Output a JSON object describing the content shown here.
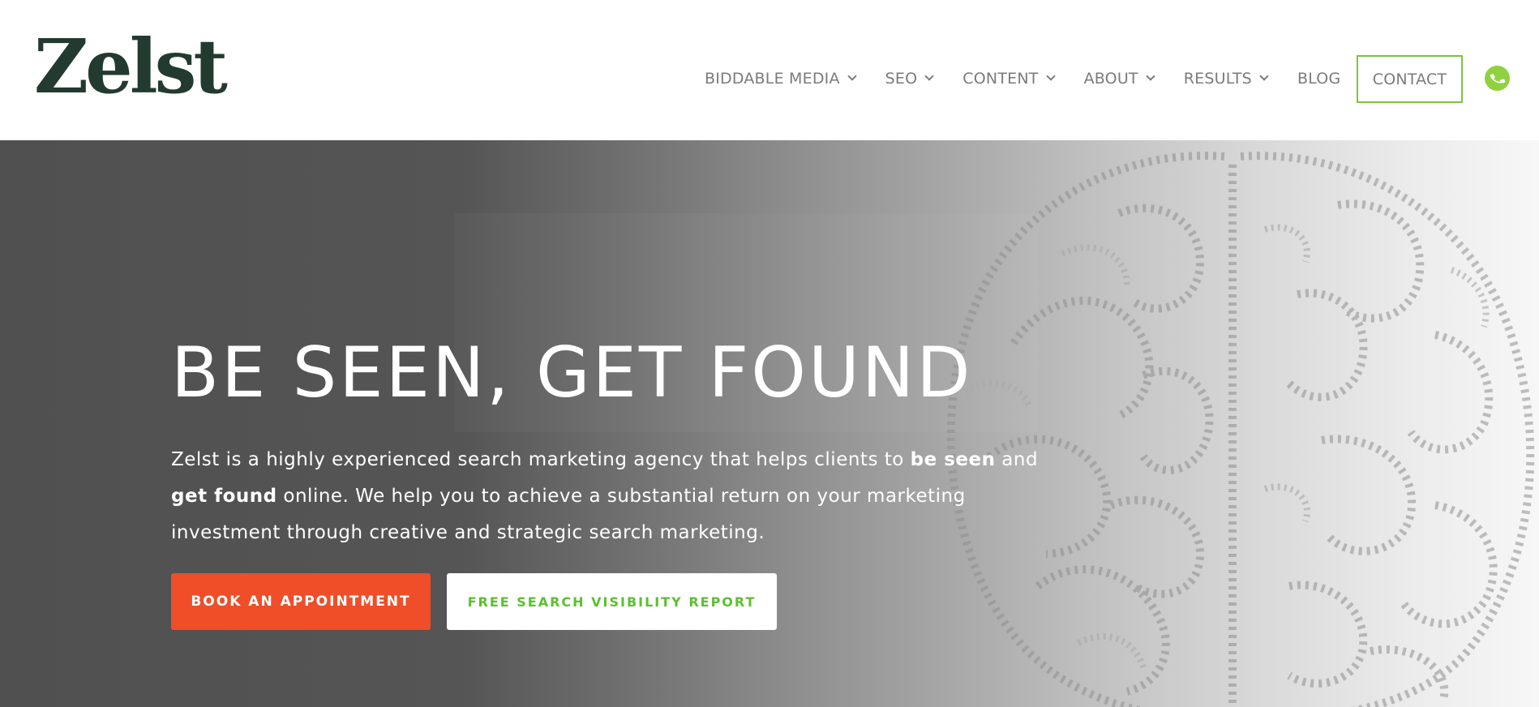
{
  "header": {
    "logo": "Zelst",
    "nav": [
      {
        "label": "BIDDABLE MEDIA",
        "dropdown": true
      },
      {
        "label": "SEO",
        "dropdown": true
      },
      {
        "label": "CONTENT",
        "dropdown": true
      },
      {
        "label": "ABOUT",
        "dropdown": true
      },
      {
        "label": "RESULTS",
        "dropdown": true
      },
      {
        "label": "BLOG",
        "dropdown": false
      }
    ],
    "contact_label": "CONTACT",
    "phone_icon": "phone-icon"
  },
  "hero": {
    "title": "BE SEEN, GET FOUND",
    "text_part1": "Zelst is a highly experienced search marketing agency that helps clients to ",
    "text_bold1": "be seen",
    "text_part2": " and",
    "text_bold2": "get found",
    "text_part3": " online. We help you to achieve a substantial return on your marketing investment through creative and strategic search marketing.",
    "book_button": "BOOK AN APPOINTMENT",
    "report_button": "FREE SEARCH VISIBILITY REPORT",
    "background_icon": "binary-brain-icon"
  },
  "colors": {
    "logo": "#223a30",
    "accent_green": "#7cc53c",
    "cta_orange": "#ef4e28",
    "report_green": "#5cc030",
    "nav_text": "#7b7b7b"
  }
}
